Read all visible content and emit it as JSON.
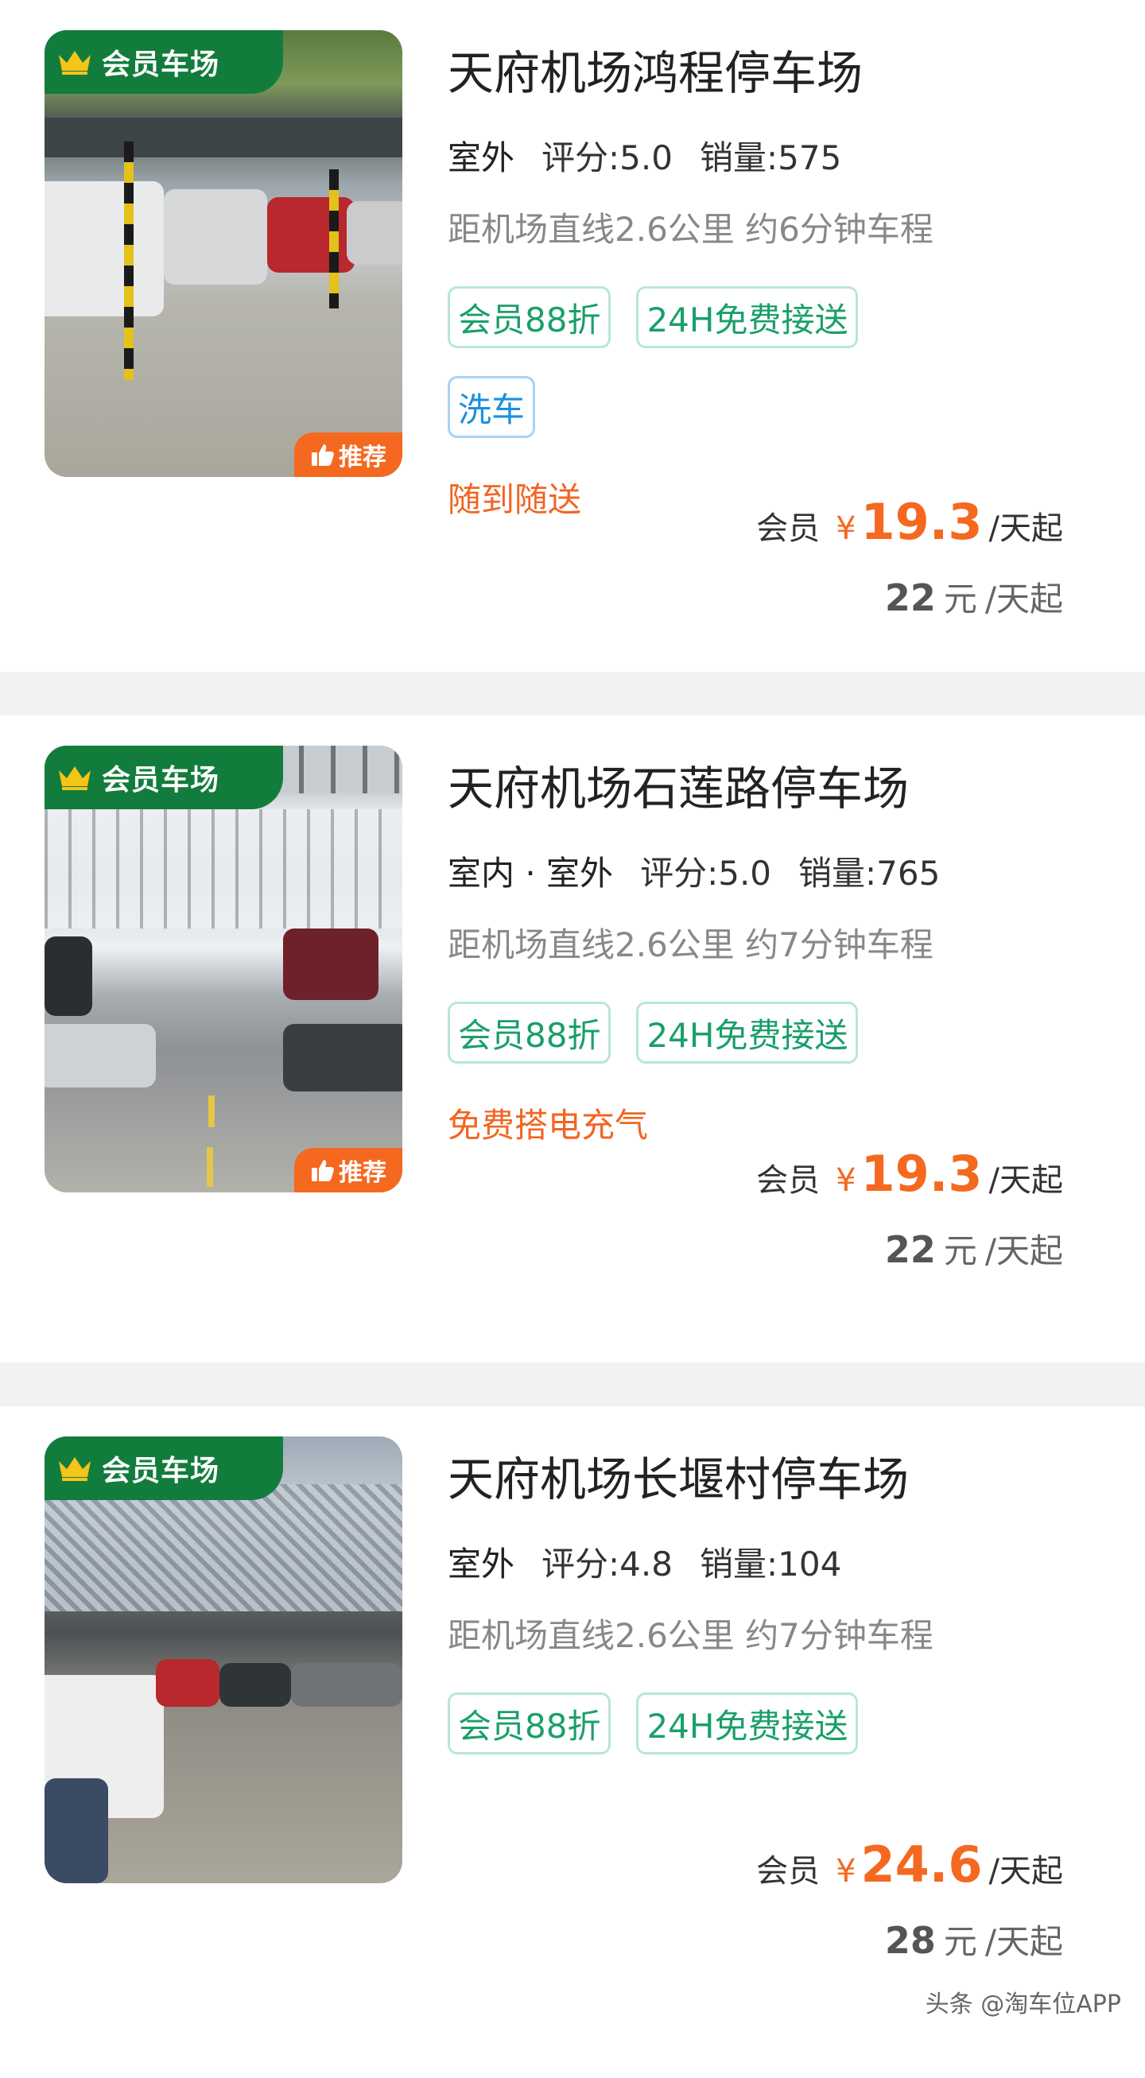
{
  "lots": [
    {
      "vip_badge": "会员车场",
      "recommend_badge": "推荐",
      "name": "天府机场鸿程停车场",
      "location_type": "室外",
      "rating_label": "评分:",
      "rating": "5.0",
      "sales_label": "销量:",
      "sales": "575",
      "distance": "距机场直线2.6公里 约6分钟车程",
      "tags": [
        "会员88折",
        "24H免费接送"
      ],
      "extra_tags": [
        "洗车"
      ],
      "promo": "随到随送",
      "member_label": "会员",
      "currency": "¥",
      "member_price": "19.3",
      "price_unit": "/天起",
      "original_price": "22",
      "original_unit": "元",
      "original_suffix": "/天起"
    },
    {
      "vip_badge": "会员车场",
      "recommend_badge": "推荐",
      "name": "天府机场石莲路停车场",
      "location_type": "室内 · 室外",
      "rating_label": "评分:",
      "rating": "5.0",
      "sales_label": "销量:",
      "sales": "765",
      "distance": "距机场直线2.6公里 约7分钟车程",
      "tags": [
        "会员88折",
        "24H免费接送"
      ],
      "extra_tags": [],
      "promo": "免费搭电充气",
      "member_label": "会员",
      "currency": "¥",
      "member_price": "19.3",
      "price_unit": "/天起",
      "original_price": "22",
      "original_unit": "元",
      "original_suffix": "/天起"
    },
    {
      "vip_badge": "会员车场",
      "recommend_badge": "",
      "name": "天府机场长堰村停车场",
      "location_type": "室外",
      "rating_label": "评分:",
      "rating": "4.8",
      "sales_label": "销量:",
      "sales": "104",
      "distance": "距机场直线2.6公里 约7分钟车程",
      "tags": [
        "会员88折",
        "24H免费接送"
      ],
      "extra_tags": [],
      "promo": "",
      "member_label": "会员",
      "currency": "¥",
      "member_price": "24.6",
      "price_unit": "/天起",
      "original_price": "28",
      "original_unit": "元",
      "original_suffix": "/天起"
    }
  ],
  "watermark": "头条 @淘车位APP",
  "colors": {
    "vip_green": "#127c3c",
    "accent_orange": "#f4691f",
    "tag_green": "#1a9f6a",
    "tag_blue": "#1b8fe0",
    "separator": "#f2f2f2"
  },
  "icons": [
    "crown-icon",
    "thumbs-up-icon"
  ]
}
